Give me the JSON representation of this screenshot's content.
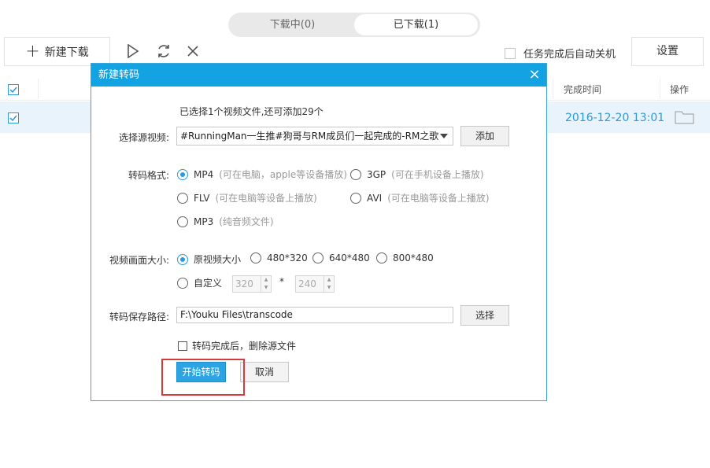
{
  "tabs": {
    "downloading": "下载中(0)",
    "downloaded": "已下载(1)"
  },
  "toolbar": {
    "new_download": "新建下载",
    "auto_shutdown": "任务完成后自动关机",
    "settings": "设置"
  },
  "list": {
    "header_complete_time": "完成时间",
    "header_action": "操作",
    "row_time": "2016-12-20 13:01"
  },
  "dialog": {
    "title": "新建转码",
    "info": "已选择1个视频文件,还可添加29个",
    "source_label": "选择源视频:",
    "source_value": "#RunningMan一生推#狗哥与RM成员们一起完成的-RM之歌",
    "add_button": "添加",
    "format_label": "转码格式:",
    "formats": [
      {
        "name": "MP4",
        "hint": "(可在电脑，apple等设备播放)",
        "selected": true
      },
      {
        "name": "3GP",
        "hint": "(可在手机设备上播放)",
        "selected": false
      },
      {
        "name": "FLV",
        "hint": "(可在电脑等设备上播放)",
        "selected": false
      },
      {
        "name": "AVI",
        "hint": "(可在电脑等设备上播放)",
        "selected": false
      },
      {
        "name": "MP3",
        "hint": "(纯音频文件)",
        "selected": false
      }
    ],
    "size_label": "视频画面大小:",
    "sizes": [
      {
        "name": "原视频大小",
        "selected": true
      },
      {
        "name": "480*320",
        "selected": false
      },
      {
        "name": "640*480",
        "selected": false
      },
      {
        "name": "800*480",
        "selected": false
      }
    ],
    "custom_label": "自定义",
    "custom_width": "320",
    "custom_height": "240",
    "times_sign": "*",
    "path_label": "转码保存路径:",
    "path_value": "F:\\Youku Files\\transcode",
    "choose_button": "选择",
    "delete_source": "转码完成后，删除源文件",
    "start_button": "开始转码",
    "cancel_button": "取消",
    "close_glyph": "×"
  },
  "colors": {
    "accent": "#13a3e3",
    "highlight_box": "#d63a3a",
    "link_text": "#2b99dc"
  }
}
